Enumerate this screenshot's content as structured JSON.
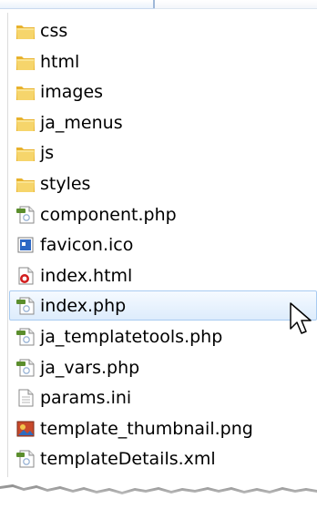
{
  "file_list": {
    "items": [
      {
        "name": "css",
        "type": "folder",
        "icon": "folder-icon"
      },
      {
        "name": "html",
        "type": "folder",
        "icon": "folder-icon"
      },
      {
        "name": "images",
        "type": "folder",
        "icon": "folder-icon"
      },
      {
        "name": "ja_menus",
        "type": "folder",
        "icon": "folder-icon"
      },
      {
        "name": "js",
        "type": "folder",
        "icon": "folder-icon"
      },
      {
        "name": "styles",
        "type": "folder",
        "icon": "folder-icon"
      },
      {
        "name": "component.php",
        "type": "file",
        "icon": "php-file-icon"
      },
      {
        "name": "favicon.ico",
        "type": "file",
        "icon": "ico-file-icon"
      },
      {
        "name": "index.html",
        "type": "file",
        "icon": "html-file-icon"
      },
      {
        "name": "index.php",
        "type": "file",
        "icon": "php-file-icon",
        "selected": true
      },
      {
        "name": "ja_templatetools.php",
        "type": "file",
        "icon": "php-file-icon"
      },
      {
        "name": "ja_vars.php",
        "type": "file",
        "icon": "php-file-icon"
      },
      {
        "name": "params.ini",
        "type": "file",
        "icon": "ini-file-icon"
      },
      {
        "name": "template_thumbnail.png",
        "type": "file",
        "icon": "image-file-icon"
      },
      {
        "name": "templateDetails.xml",
        "type": "file",
        "icon": "xml-file-icon"
      }
    ]
  },
  "colors": {
    "selection_fill": "#ddecfc",
    "selection_border": "#a8cbf1",
    "folder": "#f4c542",
    "php_badge": "#5b8e2d"
  }
}
